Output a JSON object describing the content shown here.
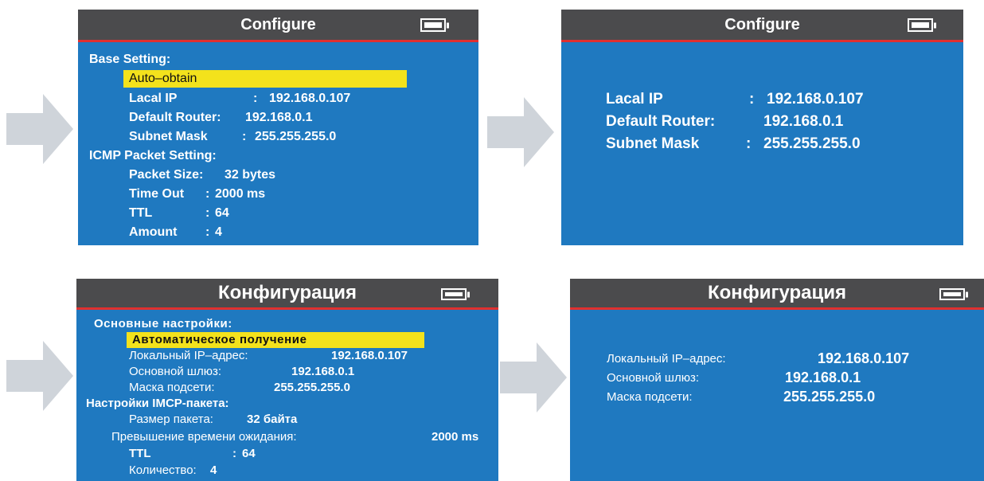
{
  "screens": {
    "en_config": {
      "title": "Configure",
      "base_setting": "Base Setting:",
      "auto_obtain": "Auto–obtain",
      "local_ip_label": "Lacal IP",
      "local_ip_sep": ":",
      "local_ip_value": "192.168.0.107",
      "router_label": "Default Router:",
      "router_value": "192.168.0.1",
      "subnet_label": "Subnet Mask",
      "subnet_sep": ":",
      "subnet_value": "255.255.255.0",
      "icmp_setting": "ICMP Packet Setting:",
      "packet_size_label": "Packet Size:",
      "packet_size_value": "32 bytes",
      "timeout_label": "Time Out",
      "timeout_sep": ":",
      "timeout_value": "2000 ms",
      "ttl_label": "TTL",
      "ttl_sep": ":",
      "ttl_value": "64",
      "amount_label": "Amount",
      "amount_sep": ":",
      "amount_value": "4"
    },
    "en_result": {
      "title": "Configure",
      "local_ip_label": "Lacal IP",
      "local_ip_sep": ":",
      "local_ip_value": "192.168.0.107",
      "router_label": "Default Router:",
      "router_value": "192.168.0.1",
      "subnet_label": "Subnet Mask",
      "subnet_sep": ":",
      "subnet_value": "255.255.255.0"
    },
    "ru_config": {
      "title": "Конфигурация",
      "base_setting": "Основные настройки:",
      "auto_obtain": "Автоматическое получение",
      "local_ip_label": "Локальный IP–адрес:",
      "local_ip_value": "192.168.0.107",
      "router_label": "Основной шлюз:",
      "router_value": "192.168.0.1",
      "subnet_label": "Маска подсети:",
      "subnet_value": "255.255.255.0",
      "icmp_setting": "Настройки IMCP-пакета:",
      "packet_size_label": "Размер пакета:",
      "packet_size_value": "32 байта",
      "timeout_label": "Превышение времени ожидания:",
      "timeout_value": "2000 ms",
      "ttl_label": "TTL",
      "ttl_sep": ":",
      "ttl_value": "64",
      "amount_label": "Количество:",
      "amount_value": "4"
    },
    "ru_result": {
      "title": "Конфигурация",
      "local_ip_label": "Локальный IP–адрес:",
      "local_ip_value": "192.168.0.107",
      "router_label": "Основной шлюз:",
      "router_value": "192.168.0.1",
      "subnet_label": "Маска подсети:",
      "subnet_value": "255.255.255.0"
    }
  },
  "icons": {
    "arrow": "arrow-right-icon",
    "battery": "battery-full-icon"
  },
  "colors": {
    "screen_bg": "#1f79c0",
    "titlebar_bg": "#4b4b4d",
    "titlebar_border": "#e0302f",
    "highlight": "#f3e21c",
    "arrow": "#cfd4da"
  }
}
